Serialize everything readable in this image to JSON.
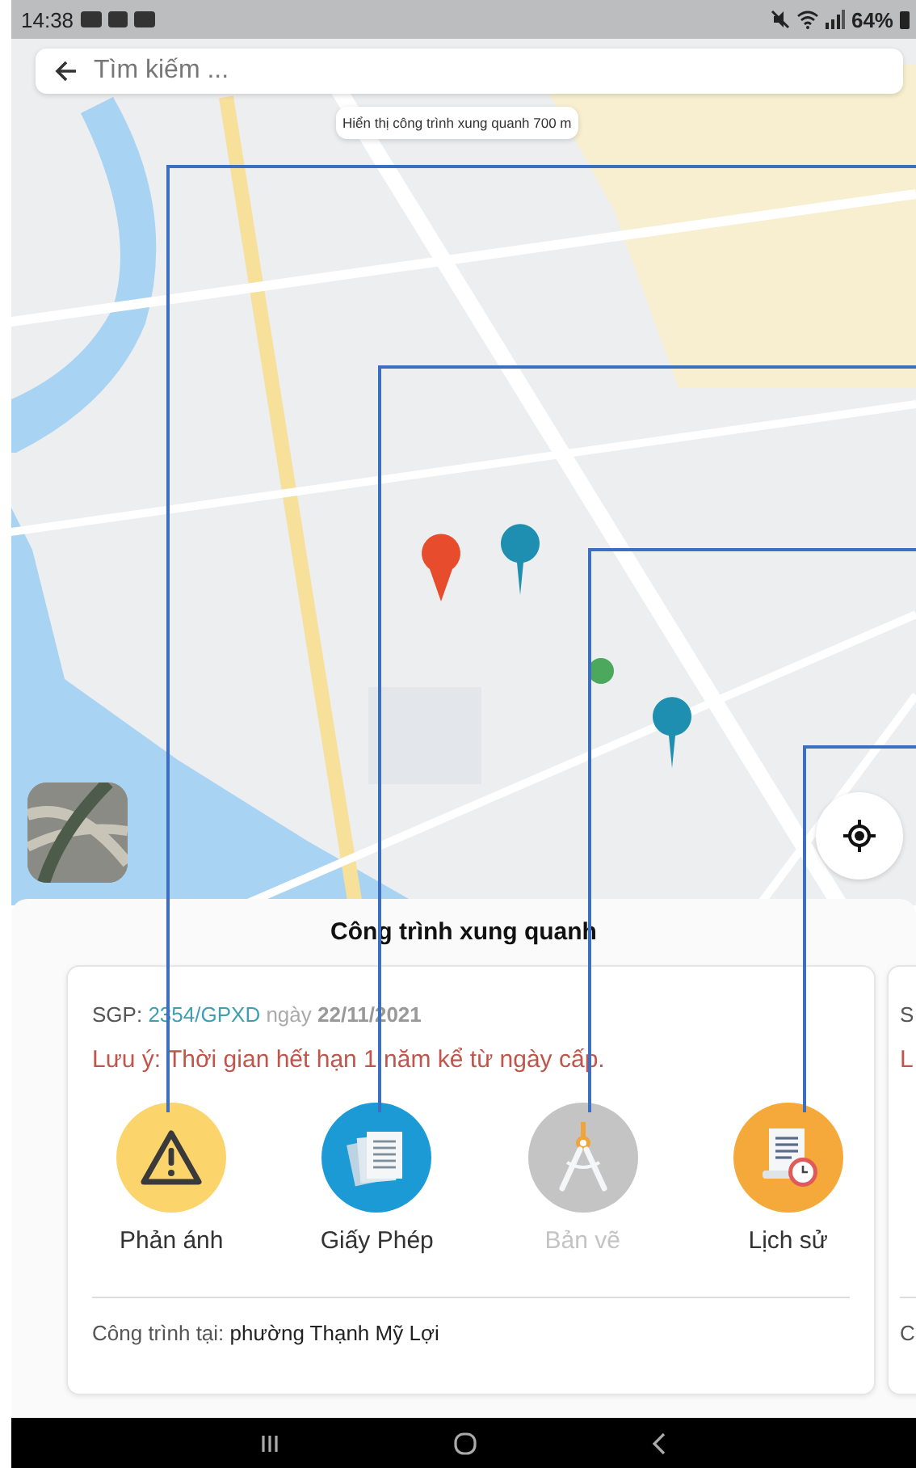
{
  "status_bar": {
    "time": "14:38",
    "battery": "64%"
  },
  "search": {
    "placeholder": "Tìm kiếm ..."
  },
  "map": {
    "kind": "picture",
    "tooltip": "Hiển thị công trình xung quanh 700 m"
  },
  "sheet": {
    "title": "Công trình xung quanh",
    "cards": [
      {
        "permit_label": "SGP:",
        "permit_number": "2354/GPXD",
        "date_label": "ngày",
        "date": "22/11/2021",
        "note": "Lưu ý: Thời gian hết hạn 1 năm kể từ ngày cấp.",
        "actions": [
          {
            "label": "Phản ánh",
            "kind": "warning",
            "disabled": false
          },
          {
            "label": "Giấy Phép",
            "kind": "documents",
            "disabled": false
          },
          {
            "label": "Bản vẽ",
            "kind": "compass",
            "disabled": true
          },
          {
            "label": "Lịch sử",
            "kind": "history",
            "disabled": false
          }
        ],
        "location_label": "Công trình tại:",
        "location": "phường Thạnh Mỹ Lợi"
      },
      {
        "permit_label": "S",
        "note": "L",
        "location_label": "C"
      }
    ]
  }
}
